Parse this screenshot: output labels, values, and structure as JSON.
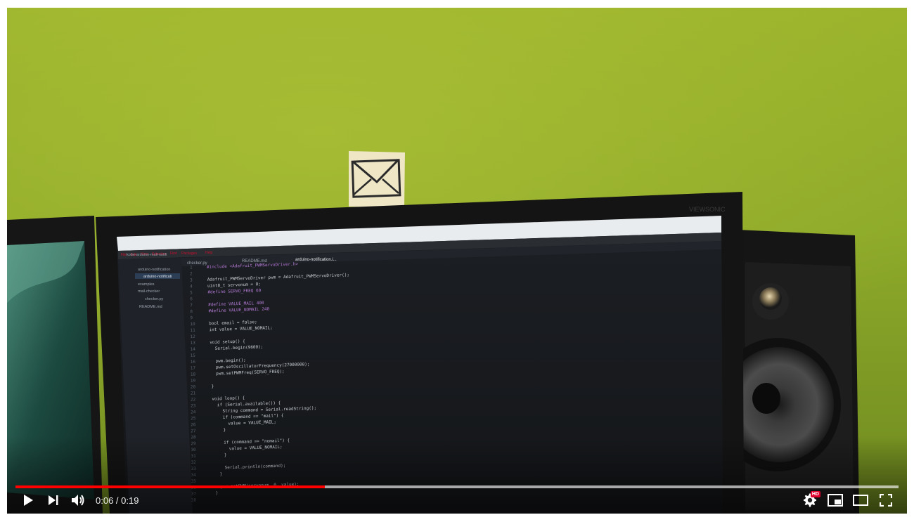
{
  "video": {
    "time_current": "0:06",
    "time_separator": " / ",
    "time_total": "0:19",
    "progress_played_fraction": 0.35,
    "progress_loaded_fraction": 1.0,
    "accent_color": "#ff0000",
    "hd_badge": "HD"
  },
  "editor": {
    "tabs": [
      "checker.py",
      "README.md",
      "arduino-notification.i..."
    ],
    "tree": [
      "kobe-arduino-mail-notifi",
      "arduino-notification",
      "arduino-notificati",
      "examples",
      "mail-checker",
      "checker.py",
      "README.md"
    ],
    "line_numbers": [
      "1",
      "2",
      "3",
      "4",
      "5",
      "6",
      "7",
      "8",
      "9",
      "10",
      "11",
      "12",
      "13",
      "14",
      "15",
      "16",
      "17",
      "18",
      "19",
      "20",
      "21",
      "22",
      "23",
      "24",
      "25",
      "26",
      "27",
      "28",
      "29",
      "30",
      "31",
      "32",
      "33",
      "34",
      "35",
      "36",
      "37",
      "38"
    ],
    "code_lines": [
      "#include <Adafruit_PWMServoDriver.h>",
      "",
      "Adafruit_PWMServoDriver pwm = Adafruit_PWMServoDriver();",
      "uint8_t servonum = 0;",
      "#define SERVO_FREQ 60",
      "",
      "#define VALUE_MAIL 400",
      "#define VALUE_NOMAIL 240",
      "",
      "bool email = false;",
      "int value = VALUE_NOMAIL;",
      "",
      "void setup() {",
      "  Serial.begin(9600);",
      "",
      "  pwm.begin();",
      "  pwm.setOscillatorFrequency(27000000);",
      "  pwm.setPWMFreq(SERVO_FREQ);",
      "",
      "}",
      "",
      "void loop() {",
      "  if (Serial.available()) {",
      "    String command = Serial.readString();",
      "    if (command == \"mail\") {",
      "      value = VALUE_MAIL;",
      "    }",
      "",
      "    if (command == \"nomail\") {",
      "      value = VALUE_NOMAIL;",
      "    }",
      "",
      "    Serial.println(command);",
      "  }",
      "",
      "  pwm.setPWM(servonum, 0, value);",
      "}",
      ""
    ],
    "monitor_brand": "VIEWSONIC"
  },
  "icons": {
    "play": "play-icon",
    "next": "next-icon",
    "volume": "volume-icon",
    "settings": "settings-icon",
    "miniplayer": "miniplayer-icon",
    "theater": "theater-icon",
    "fullscreen": "fullscreen-icon",
    "envelope": "envelope-icon"
  }
}
